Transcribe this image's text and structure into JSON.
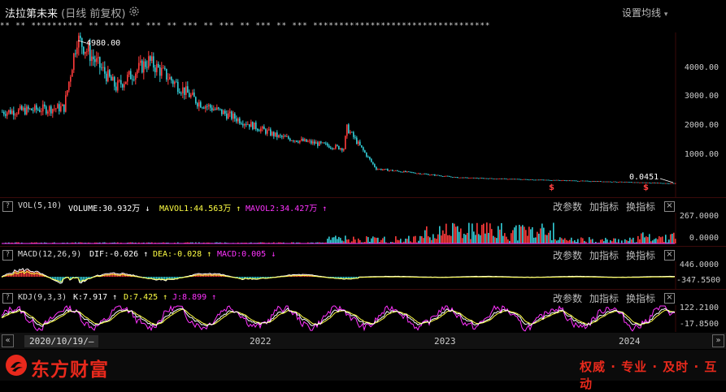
{
  "header": {
    "stock_name": "法拉第未来",
    "mode_label": "(日线 前复权)",
    "set_ma_label": "设置均线",
    "ma_placeholder_row": "** **         ********** ** **** ** ***     ** *** ** *** ** *** ** *** **********************************"
  },
  "price_panel": {
    "high_annotation": "4980.00",
    "last_annotation": "0.0451",
    "y_ticks": [
      "4000.00",
      "3000.00",
      "2000.00",
      "1000.00"
    ]
  },
  "vol_panel": {
    "name": "VOL(5,10)",
    "vol_label": "VOLUME:30.932万",
    "ma1_label": "MAVOL1:44.563万",
    "ma2_label": "MAVOL2:34.427万",
    "y_ticks": [
      "267.0000",
      "0.0000"
    ]
  },
  "macd_panel": {
    "name": "MACD(12,26,9)",
    "dif_label": "DIF:-0.026",
    "dea_label": "DEA:-0.028",
    "macd_label": "MACD:0.005",
    "y_ticks": [
      "446.0000",
      "-347.5500"
    ]
  },
  "kdj_panel": {
    "name": "KDJ(9,3,3)",
    "k_label": "K:7.917",
    "d_label": "D:7.425",
    "j_label": "J:8.899",
    "y_ticks": [
      "122.2100",
      "-17.8500"
    ]
  },
  "panel_buttons": {
    "params": "改参数",
    "add_indicator": "加指标",
    "switch_indicator": "换指标",
    "close": "×",
    "question": "?"
  },
  "timeline": {
    "start_date": "2020/10/19/—",
    "years": [
      "2022",
      "2023",
      "2024"
    ]
  },
  "footer": {
    "brand": "东方财富",
    "slogan": "权威 · 专业 · 及时 · 互动"
  },
  "colors": {
    "up": "#ff3b3b",
    "down": "#33ccd6",
    "yellow": "#ffff44",
    "magenta": "#ff33ff",
    "white": "#ffffff",
    "brand_red": "#e8291c"
  },
  "chart_data": {
    "type": "candlestick",
    "x_range": [
      "2020/10/19",
      "2024"
    ],
    "y_range_price": [
      0,
      4980
    ],
    "price_path_approx": [
      {
        "x": "2020/10/19",
        "close": 2450
      },
      {
        "x": "2021-01",
        "close": 2600
      },
      {
        "x": "2021-02",
        "close": 4980
      },
      {
        "x": "2021-04",
        "close": 3300
      },
      {
        "x": "2021-06",
        "close": 4200
      },
      {
        "x": "2021-09",
        "close": 2800
      },
      {
        "x": "2022-01",
        "close": 1600
      },
      {
        "x": "2022-06",
        "close": 1200
      },
      {
        "x": "2022-08",
        "close": 1900
      },
      {
        "x": "2022-10",
        "close": 500
      },
      {
        "x": "2023-03",
        "close": 200
      },
      {
        "x": "2024",
        "close": 0.0451
      }
    ]
  }
}
